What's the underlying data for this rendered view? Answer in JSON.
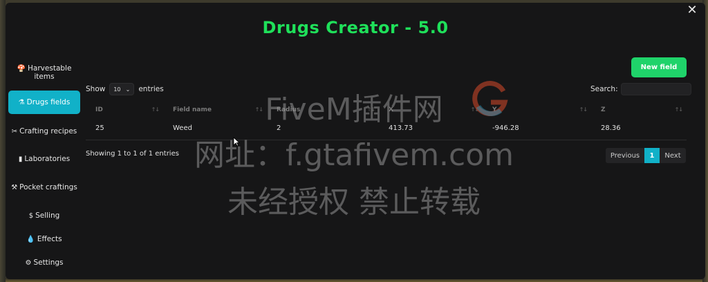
{
  "app": {
    "title": "Drugs Creator - 5.0"
  },
  "sidebar": {
    "items": [
      {
        "icon": "harvest-icon",
        "glyph": "🍄",
        "label": "Harvestable items",
        "active": false
      },
      {
        "icon": "flask-icon",
        "glyph": "⚗",
        "label": "Drugs fields",
        "active": true
      },
      {
        "icon": "tools-icon",
        "glyph": "✂",
        "label": "Crafting recipes",
        "active": false
      },
      {
        "icon": "chart-icon",
        "glyph": "▮",
        "label": "Laboratories",
        "active": false
      },
      {
        "icon": "hammer-icon",
        "glyph": "⚒",
        "label": "Pocket craftings",
        "active": false
      },
      {
        "icon": "dollar-icon",
        "glyph": "$",
        "label": "Selling",
        "active": false
      },
      {
        "icon": "droplet-icon",
        "glyph": "💧",
        "label": "Effects",
        "active": false
      },
      {
        "icon": "gear-icon",
        "glyph": "⚙",
        "label": "Settings",
        "active": false
      }
    ]
  },
  "toolbar": {
    "new_label": "New field"
  },
  "table_controls": {
    "show_label": "Show",
    "page_size": "10",
    "entries_label": "entries",
    "search_label": "Search:",
    "search_value": ""
  },
  "table": {
    "columns": [
      "ID",
      "Field name",
      "Radius",
      "X",
      "Y",
      "Z"
    ],
    "rows": [
      [
        "25",
        "Weed",
        "2",
        "413.73",
        "-946.28",
        "28.36"
      ]
    ]
  },
  "footer": {
    "info": "Showing 1 to 1 of 1 entries",
    "prev": "Previous",
    "page": "1",
    "next": "Next"
  },
  "watermark": {
    "line1": "FiveM插件网",
    "line2": "网址：f.gtafivem.com",
    "line3": "未经授权 禁止转载"
  },
  "colors": {
    "accent": "#11b1c8",
    "title": "#1fe05a",
    "new_button": "#1fd36a",
    "panel": "#161617"
  }
}
